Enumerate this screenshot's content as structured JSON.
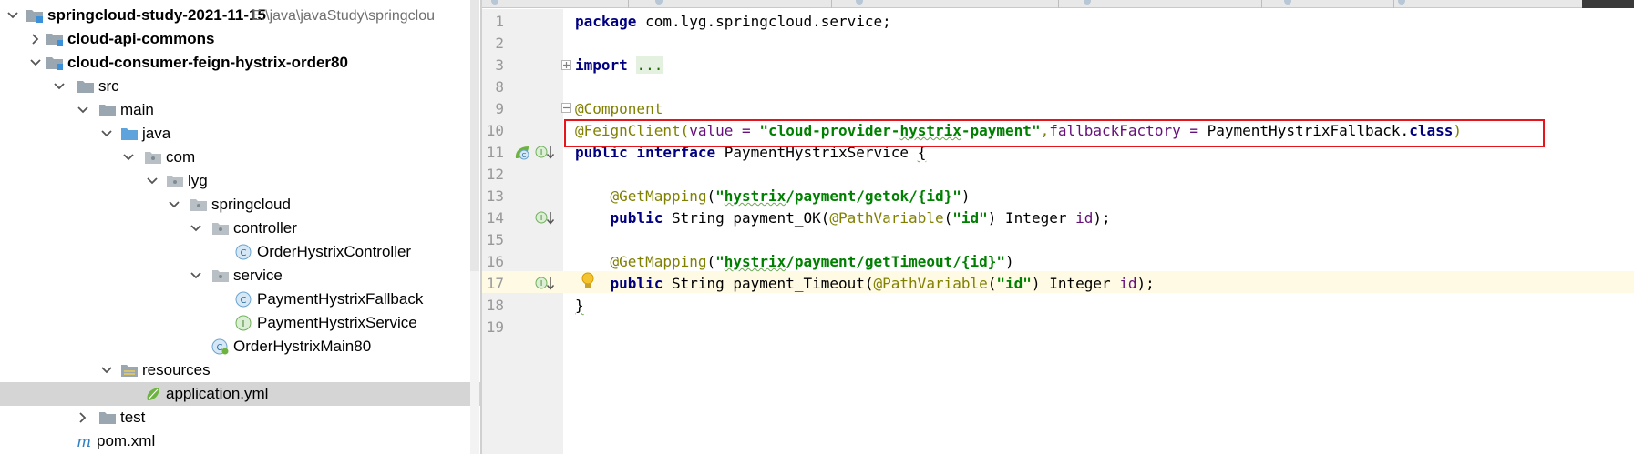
{
  "project_tree": {
    "root": {
      "label": "springcloud-study-2021-11-15",
      "path": "E:\\java\\javaStudy\\springclou"
    },
    "items": [
      {
        "label": "cloud-api-commons",
        "bold": true,
        "icon": "module-folder-icon",
        "expanded": false
      },
      {
        "label": "cloud-consumer-feign-hystrix-order80",
        "bold": true,
        "icon": "module-folder-icon",
        "expanded": true
      },
      {
        "label": "src",
        "icon": "folder-icon",
        "expanded": true
      },
      {
        "label": "main",
        "icon": "folder-icon",
        "expanded": true
      },
      {
        "label": "java",
        "icon": "source-folder-icon",
        "expanded": true
      },
      {
        "label": "com",
        "icon": "package-icon",
        "expanded": true
      },
      {
        "label": "lyg",
        "icon": "package-icon",
        "expanded": true
      },
      {
        "label": "springcloud",
        "icon": "package-icon",
        "expanded": true
      },
      {
        "label": "controller",
        "icon": "package-icon",
        "expanded": true
      },
      {
        "label": "OrderHystrixController",
        "icon": "class-icon"
      },
      {
        "label": "service",
        "icon": "package-icon",
        "expanded": true
      },
      {
        "label": "PaymentHystrixFallback",
        "icon": "class-icon"
      },
      {
        "label": "PaymentHystrixService",
        "icon": "interface-icon"
      },
      {
        "label": "OrderHystrixMain80",
        "icon": "spring-boot-class-icon"
      },
      {
        "label": "resources",
        "icon": "resources-folder-icon",
        "expanded": true
      },
      {
        "label": "application.yml",
        "icon": "spring-config-icon",
        "selected": true
      },
      {
        "label": "test",
        "icon": "folder-icon",
        "expanded": false
      },
      {
        "label": "pom.xml",
        "icon": "maven-icon"
      }
    ]
  },
  "editor": {
    "line_numbers": [
      "1",
      "2",
      "3",
      "8",
      "9",
      "10",
      "11",
      "12",
      "13",
      "14",
      "15",
      "16",
      "17",
      "18",
      "19"
    ],
    "code": {
      "l1": {
        "kw": "package",
        "rest": " com.lyg.springcloud.service;"
      },
      "l3": {
        "kw": "import",
        "space": " ",
        "folded": "..."
      },
      "l9": {
        "ann": "@Component"
      },
      "l10": {
        "ann": "@FeignClient(",
        "p1": "value",
        "eq1": " = ",
        "s1_pre": "\"cloud-provider-",
        "s1_squig": "hystrix",
        "s1_post": "-payment\"",
        "comma": ",",
        "p2": "fallbackFactory",
        "eq2": " = ",
        "cls": "PaymentHystrixFallback.",
        "kw": "class",
        "close": ")"
      },
      "l11": {
        "kw": "public interface",
        "name": " PaymentHystrixService ",
        "brace": "{"
      },
      "l13": {
        "indent": "    ",
        "ann": "@GetMapping",
        "open": "(",
        "s_q": "\"",
        "s_squig": "hystrix",
        "s_rest": "/payment/getok/{id}\"",
        "close": ")"
      },
      "l14": {
        "indent": "    ",
        "kw": "public",
        "sig": " String payment_OK(",
        "ann": "@PathVariable",
        "open": "(",
        "s": "\"id\"",
        "close": ")",
        "type": " Integer ",
        "param": "id",
        "end": ");"
      },
      "l16": {
        "indent": "    ",
        "ann": "@GetMapping",
        "open": "(",
        "s_q": "\"",
        "s_squig": "hystrix",
        "s_rest": "/payment/getTimeout/{id}\"",
        "close": ")"
      },
      "l17": {
        "indent": "    ",
        "kw": "public",
        "sig": " String payment_Timeout(",
        "ann": "@PathVariable",
        "open": "(",
        "s": "\"id\"",
        "close": ")",
        "type": " Integer ",
        "param": "id",
        "end": ");"
      },
      "l18": {
        "brace": "}"
      }
    }
  },
  "colors": {
    "callout": "#e8141b",
    "keyword": "#000080",
    "annotation": "#808000",
    "string": "#008000",
    "parameter": "#660e7a",
    "current_line": "#fffae3",
    "selected_row": "#d5d5d5"
  }
}
